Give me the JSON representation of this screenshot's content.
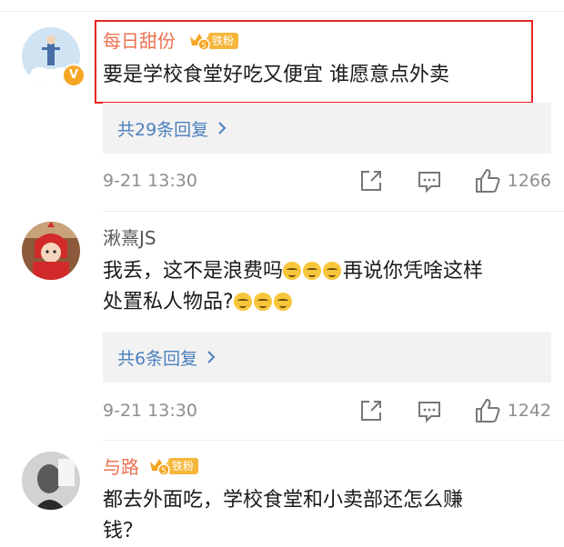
{
  "comments": [
    {
      "username": "每日甜份",
      "fan_badge": "铁粉",
      "text": "要是学校食堂好吃又便宜 谁愿意点外卖",
      "reply_label": "共29条回复",
      "time": "9-21 13:30",
      "likes": "1266",
      "verified_badge": "V"
    },
    {
      "username": "湫熹JS",
      "text_part1": "我丢，这不是浪费吗",
      "text_part2": "再说你凭啥这样",
      "text_part3": "处置私人物品?",
      "reply_label": "共6条回复",
      "time": "9-21 13:30",
      "likes": "1242"
    },
    {
      "username": "与路",
      "fan_badge": "铁粉",
      "text_line1": "都去外面吃，学校食堂和小卖部还怎么赚",
      "text_line2": "钱？"
    }
  ],
  "icons": [
    "share-icon",
    "comment-icon",
    "like-icon",
    "chevron-right-icon",
    "crown-icon",
    "smirk-emoji"
  ],
  "colors": {
    "username_orange": "#eb7350",
    "reply_link": "#4c7fbe",
    "highlight": "#e8251f",
    "fan_badge": "#f5b63a"
  }
}
